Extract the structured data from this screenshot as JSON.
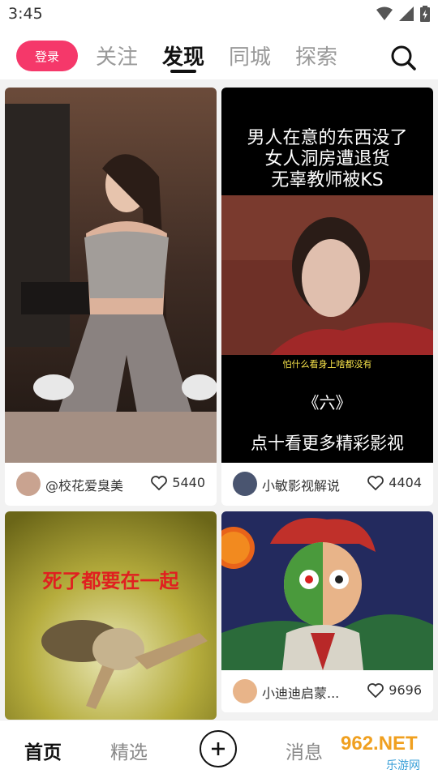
{
  "status_bar": {
    "time": "3:45"
  },
  "top_nav": {
    "login_label": "登录",
    "tabs": [
      {
        "label": "关注",
        "active": false
      },
      {
        "label": "发现",
        "active": true
      },
      {
        "label": "同城",
        "active": false
      },
      {
        "label": "探索",
        "active": false
      }
    ]
  },
  "feed": [
    {
      "author": "@校花爱臭美",
      "likes": "5440",
      "overlay_lines": []
    },
    {
      "author": "小敏影视解说",
      "likes": "4404",
      "overlay_lines": [
        "男人在意的东西没了",
        "女人洞房遭退货",
        "无辜教师被KS"
      ],
      "subtitle": "怕什么看身上啥都没有",
      "episode": "《六》",
      "cta": "点十看更多精彩影视"
    },
    {
      "author": "",
      "likes": "",
      "overlay_lines": [
        "死了都要在一起"
      ]
    },
    {
      "author": "小迪迪启蒙...",
      "likes": "9696",
      "overlay_lines": []
    }
  ],
  "bottom_nav": {
    "items": [
      {
        "label": "首页",
        "active": true
      },
      {
        "label": "精选",
        "active": false
      },
      {
        "label": "消息",
        "active": false
      }
    ]
  },
  "watermark": {
    "text": "962.NET",
    "subtext": "乐游网"
  },
  "colors": {
    "accent": "#f5386a",
    "background": "#f2f2f2"
  }
}
